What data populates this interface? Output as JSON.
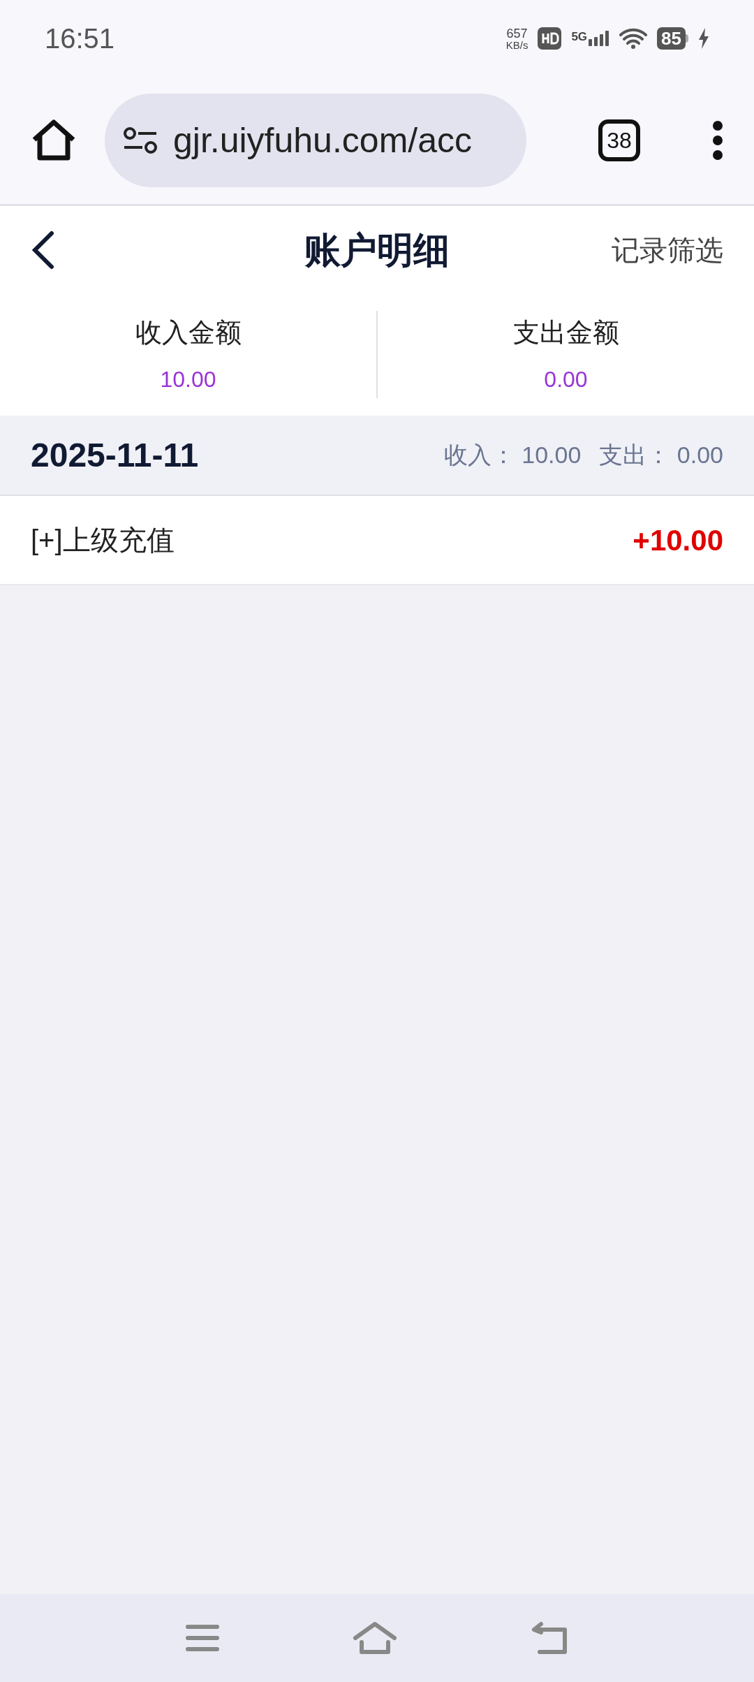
{
  "status_bar": {
    "time": "16:51",
    "net_speed": "657",
    "net_unit": "KB/s",
    "network": "5G",
    "battery": "85"
  },
  "browser": {
    "url": "gjr.uiyfuhu.com/acc",
    "tab_count": "38"
  },
  "header": {
    "title": "账户明细",
    "action": "记录筛选"
  },
  "summary": [
    {
      "label": "收入金额",
      "value": "10.00"
    },
    {
      "label": "支出金额",
      "value": "0.00"
    }
  ],
  "groups": [
    {
      "date": "2025-11-11",
      "income_label": "收入：",
      "income": "10.00",
      "expense_label": "支出：",
      "expense": "0.00",
      "records": [
        {
          "title": "[+]上级充值",
          "amount": "+10.00"
        }
      ]
    }
  ]
}
